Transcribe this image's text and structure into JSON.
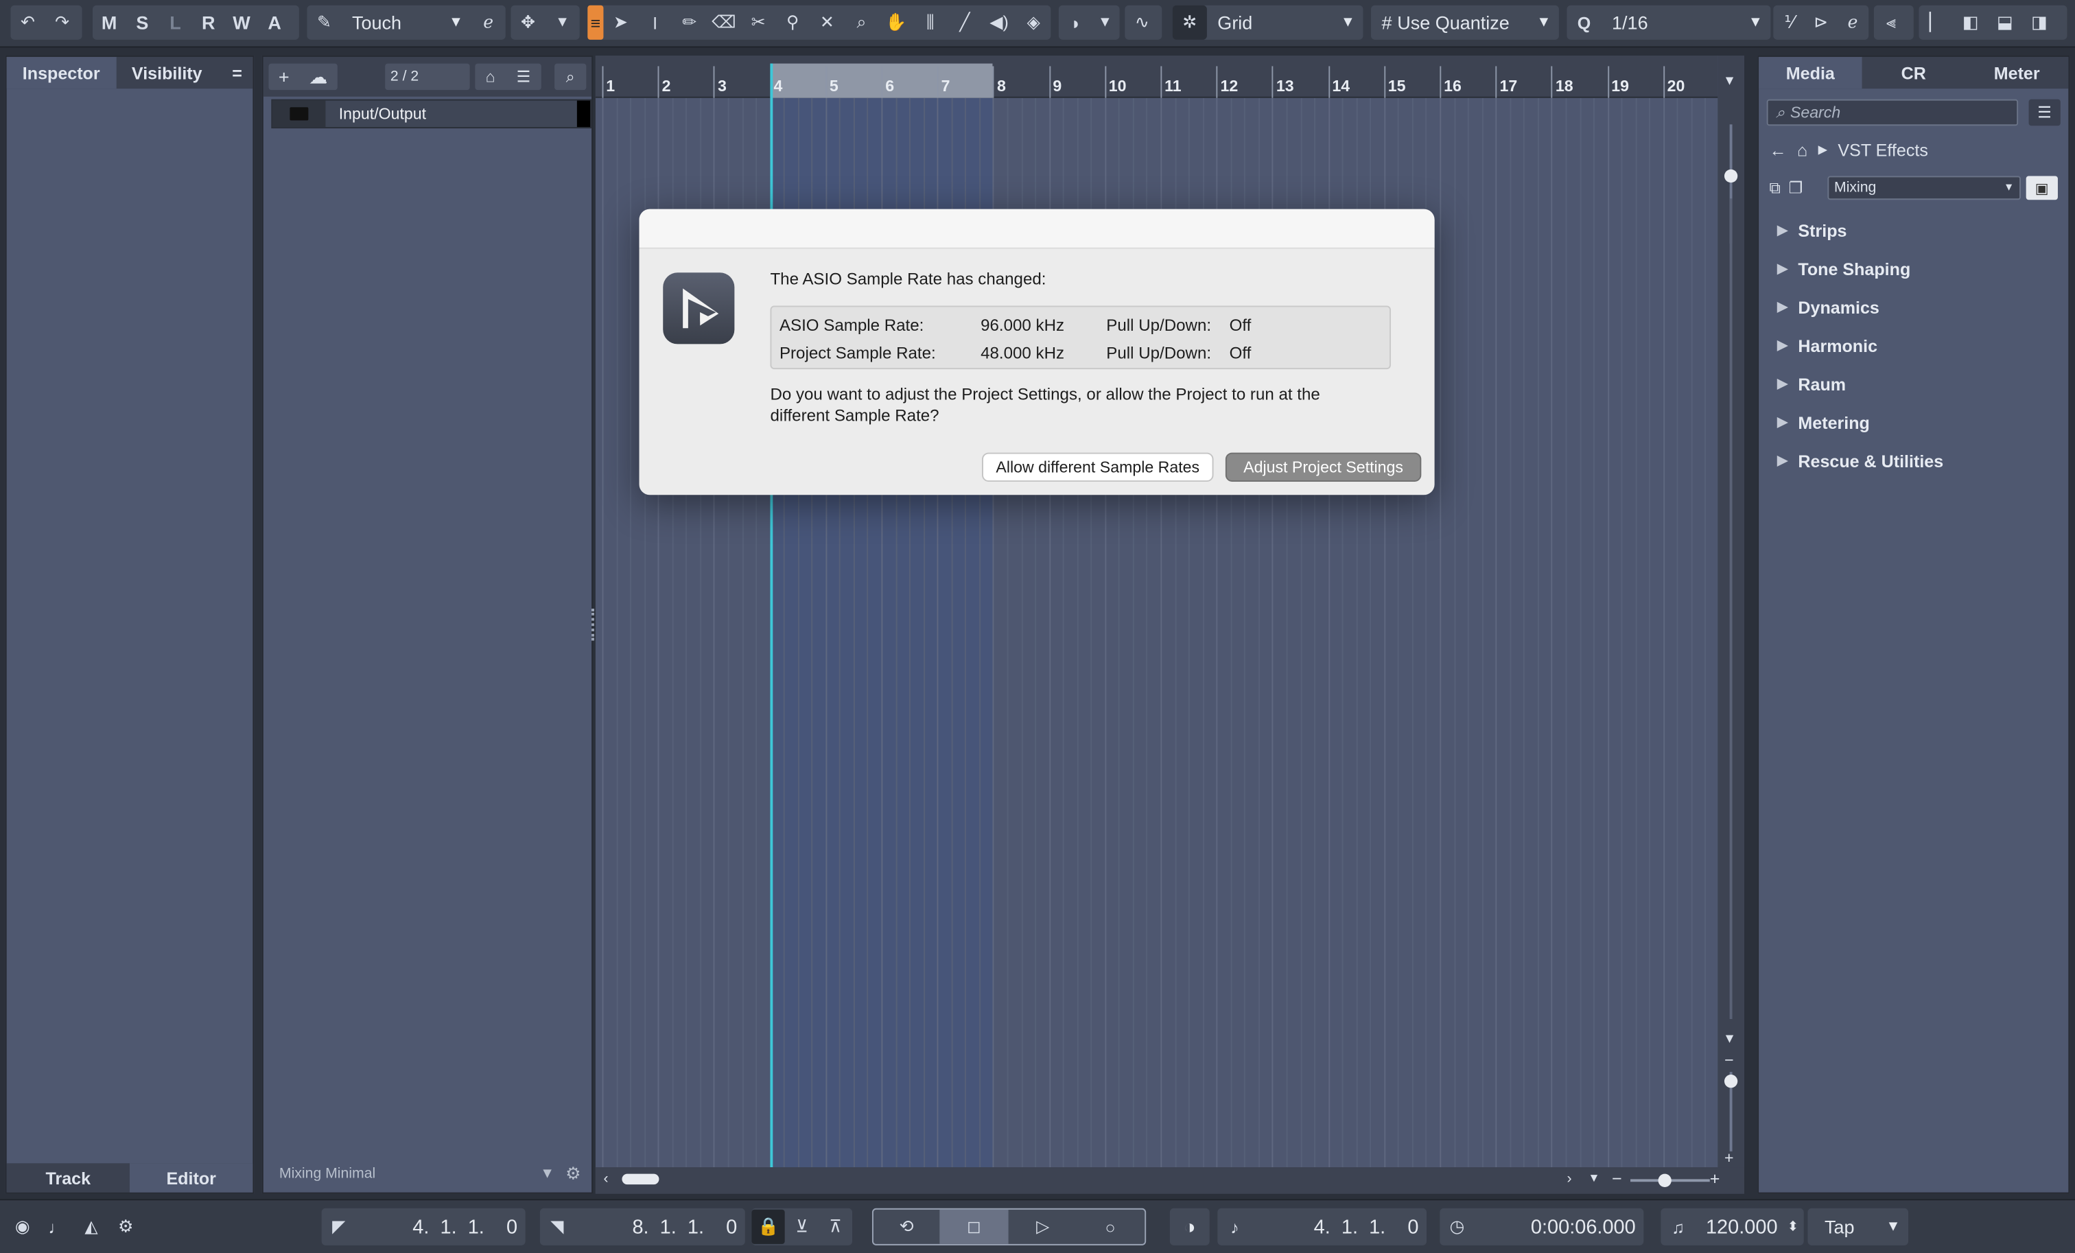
{
  "toolbar": {
    "state_letters": [
      "M",
      "S",
      "L",
      "R",
      "W",
      "A"
    ],
    "automation_mode": "Touch",
    "snap_type": "Grid",
    "quantize_mode": "Use Quantize",
    "quantize_value": "1/16"
  },
  "inspector": {
    "tabs": [
      "Inspector",
      "Visibility"
    ],
    "bottom_tabs": [
      "Track",
      "Editor"
    ]
  },
  "tracklist": {
    "count": "2 / 2",
    "track_name": "Input/Output",
    "footer": "Mixing Minimal"
  },
  "ruler": {
    "bars": [
      "1",
      "2",
      "3",
      "4",
      "5",
      "6",
      "7",
      "8",
      "9",
      "10",
      "11",
      "12",
      "13",
      "14",
      "15",
      "16",
      "17",
      "18",
      "19",
      "20"
    ],
    "cycle_start_bar": 4,
    "cycle_end_bar": 8
  },
  "media": {
    "tabs": [
      "Media",
      "CR",
      "Meter"
    ],
    "search_placeholder": "Search",
    "path": "VST Effects",
    "category": "Mixing",
    "folders": [
      "Strips",
      "Tone Shaping",
      "Dynamics",
      "Harmonic",
      "Raum",
      "Metering",
      "Rescue & Utilities"
    ]
  },
  "transport": {
    "left_locator": "4.  1.  1.    0",
    "right_locator": "8.  1.  1.    0",
    "position_bars": "4.  1.  1.    0",
    "position_time": "0:00:06.000",
    "tempo": "120.000",
    "tap_label": "Tap"
  },
  "dialog": {
    "heading": "The ASIO Sample Rate has changed:",
    "rows": [
      {
        "label": "ASIO Sample Rate:",
        "value": "96.000 kHz",
        "pull_label": "Pull Up/Down:",
        "pull_value": "Off"
      },
      {
        "label": "Project Sample Rate:",
        "value": "48.000 kHz",
        "pull_label": "Pull Up/Down:",
        "pull_value": "Off"
      }
    ],
    "question_line1": "Do you want to adjust the Project Settings, or allow the Project to run at the",
    "question_line2": "different Sample Rate?",
    "allow_button": "Allow different Sample Rates",
    "adjust_button": "Adjust Project Settings"
  }
}
